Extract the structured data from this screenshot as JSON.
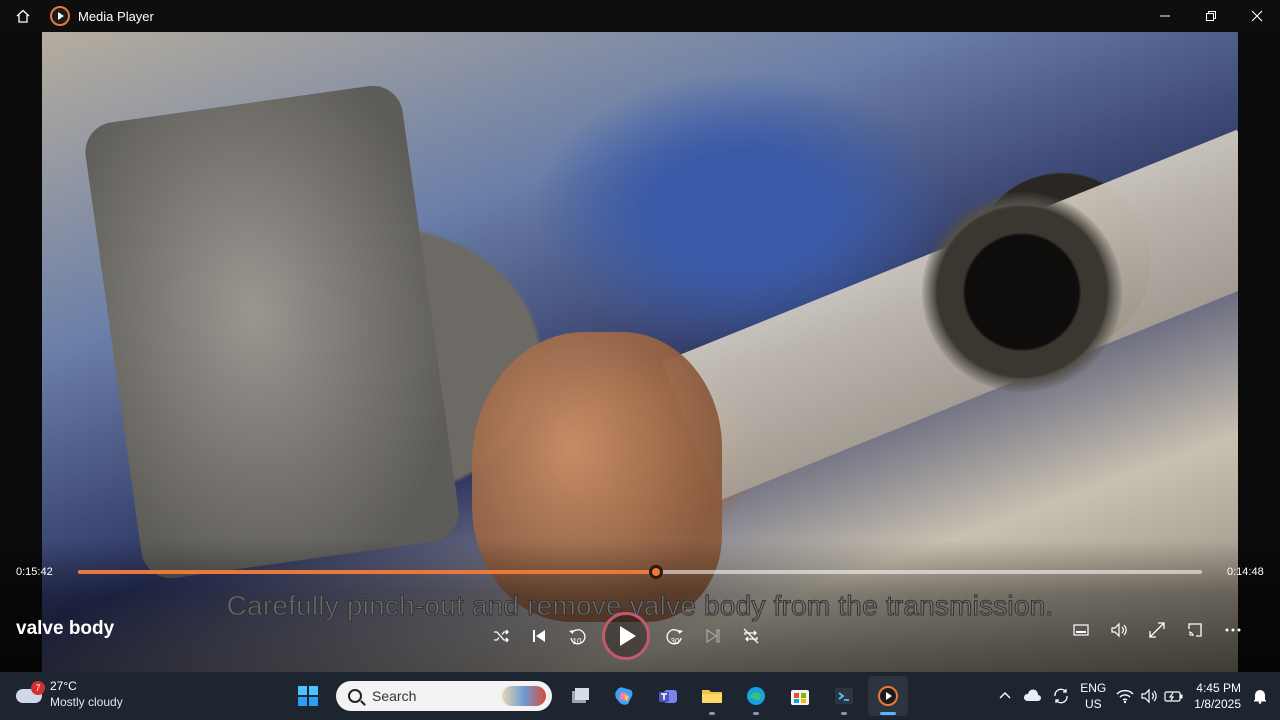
{
  "window": {
    "title": "Media Player",
    "controls": {
      "home_icon": "home-icon",
      "minimize_icon": "minimize-icon",
      "restore_icon": "restore-icon",
      "close_icon": "close-icon"
    }
  },
  "player": {
    "elapsed": "0:15:42",
    "remaining": "0:14:48",
    "progress_fraction": 0.514,
    "caption": "Carefully pinch-out and remove valve body from the transmission.",
    "media_title": "valve body",
    "skip_back_seconds": "10",
    "skip_forward_seconds": "30",
    "accent_color": "#e8793a",
    "buttons": [
      "shuffle",
      "previous",
      "skip-back-10",
      "play",
      "skip-forward-30",
      "next",
      "repeat-off"
    ],
    "right_buttons": [
      "miniplayer",
      "volume",
      "fullscreen",
      "cast",
      "more"
    ]
  },
  "taskbar": {
    "weather": {
      "badge": "7",
      "temperature": "27°C",
      "condition": "Mostly cloudy"
    },
    "search_placeholder": "Search",
    "pinned": [
      "start",
      "search",
      "task-view",
      "copilot",
      "teams",
      "file-explorer",
      "edge",
      "microsoft-store",
      "terminal",
      "media-player"
    ],
    "active_app": "media-player",
    "tray": {
      "language_line1": "ENG",
      "language_line2": "US",
      "time": "4:45 PM",
      "date": "1/8/2025"
    }
  }
}
